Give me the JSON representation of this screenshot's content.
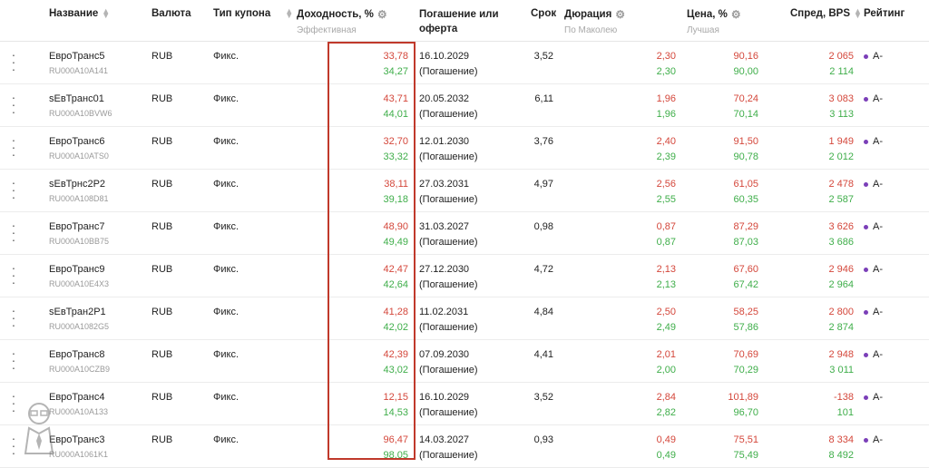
{
  "header": {
    "name": "Название",
    "currency": "Валюта",
    "coupon_type": "Тип купона",
    "yield": "Доходность, %",
    "yield_sub": "Эффективная",
    "maturity": "Погашение или оферта",
    "term": "Срок",
    "duration": "Дюрация",
    "duration_sub": "По Маколею",
    "price": "Цена, %",
    "price_sub": "Лучшая",
    "spread": "Спред, BPS",
    "rating": "Рейтинг"
  },
  "rows": [
    {
      "name": "ЕвроТранс5",
      "isin": "RU000A10A141",
      "currency": "RUB",
      "coupon": "Фикс.",
      "yield1": "33,78",
      "yield2": "34,27",
      "maturity": "16.10.2029",
      "maturity_note": "(Погашение)",
      "term": "3,52",
      "dur1": "2,30",
      "dur2": "2,30",
      "price1": "90,16",
      "price2": "90,00",
      "spread1": "2 065",
      "spread2": "2 114",
      "rating": "A-"
    },
    {
      "name": "sЕвТранс01",
      "isin": "RU000A10BVW6",
      "currency": "RUB",
      "coupon": "Фикс.",
      "yield1": "43,71",
      "yield2": "44,01",
      "maturity": "20.05.2032",
      "maturity_note": "(Погашение)",
      "term": "6,11",
      "dur1": "1,96",
      "dur2": "1,96",
      "price1": "70,24",
      "price2": "70,14",
      "spread1": "3 083",
      "spread2": "3 113",
      "rating": "A-"
    },
    {
      "name": "ЕвроТранс6",
      "isin": "RU000A10ATS0",
      "currency": "RUB",
      "coupon": "Фикс.",
      "yield1": "32,70",
      "yield2": "33,32",
      "maturity": "12.01.2030",
      "maturity_note": "(Погашение)",
      "term": "3,76",
      "dur1": "2,40",
      "dur2": "2,39",
      "price1": "91,50",
      "price2": "90,78",
      "spread1": "1 949",
      "spread2": "2 012",
      "rating": "A-"
    },
    {
      "name": "sЕвТрнс2P2",
      "isin": "RU000A108D81",
      "currency": "RUB",
      "coupon": "Фикс.",
      "yield1": "38,11",
      "yield2": "39,18",
      "maturity": "27.03.2031",
      "maturity_note": "(Погашение)",
      "term": "4,97",
      "dur1": "2,56",
      "dur2": "2,55",
      "price1": "61,05",
      "price2": "60,35",
      "spread1": "2 478",
      "spread2": "2 587",
      "rating": "A-"
    },
    {
      "name": "ЕвроТранс7",
      "isin": "RU000A10BB75",
      "currency": "RUB",
      "coupon": "Фикс.",
      "yield1": "48,90",
      "yield2": "49,49",
      "maturity": "31.03.2027",
      "maturity_note": "(Погашение)",
      "term": "0,98",
      "dur1": "0,87",
      "dur2": "0,87",
      "price1": "87,29",
      "price2": "87,03",
      "spread1": "3 626",
      "spread2": "3 686",
      "rating": "A-"
    },
    {
      "name": "ЕвроТранс9",
      "isin": "RU000A10E4X3",
      "currency": "RUB",
      "coupon": "Фикс.",
      "yield1": "42,47",
      "yield2": "42,64",
      "maturity": "27.12.2030",
      "maturity_note": "(Погашение)",
      "term": "4,72",
      "dur1": "2,13",
      "dur2": "2,13",
      "price1": "67,60",
      "price2": "67,42",
      "spread1": "2 946",
      "spread2": "2 964",
      "rating": "A-"
    },
    {
      "name": "sЕвТран2P1",
      "isin": "RU000A1082G5",
      "currency": "RUB",
      "coupon": "Фикс.",
      "yield1": "41,28",
      "yield2": "42,02",
      "maturity": "11.02.2031",
      "maturity_note": "(Погашение)",
      "term": "4,84",
      "dur1": "2,50",
      "dur2": "2,49",
      "price1": "58,25",
      "price2": "57,86",
      "spread1": "2 800",
      "spread2": "2 874",
      "rating": "A-"
    },
    {
      "name": "ЕвроТранс8",
      "isin": "RU000A10CZB9",
      "currency": "RUB",
      "coupon": "Фикс.",
      "yield1": "42,39",
      "yield2": "43,02",
      "maturity": "07.09.2030",
      "maturity_note": "(Погашение)",
      "term": "4,41",
      "dur1": "2,01",
      "dur2": "2,00",
      "price1": "70,69",
      "price2": "70,29",
      "spread1": "2 948",
      "spread2": "3 011",
      "rating": "A-"
    },
    {
      "name": "ЕвроТранс4",
      "isin": "RU000A10A133",
      "currency": "RUB",
      "coupon": "Фикс.",
      "yield1": "12,15",
      "yield2": "14,53",
      "maturity": "16.10.2029",
      "maturity_note": "(Погашение)",
      "term": "3,52",
      "dur1": "2,84",
      "dur2": "2,82",
      "price1": "101,89",
      "price2": "96,70",
      "spread1": "-138",
      "spread2": "101",
      "rating": "A-"
    },
    {
      "name": "ЕвроТранс3",
      "isin": "RU000A1061K1",
      "currency": "RUB",
      "coupon": "Фикс.",
      "yield1": "96,47",
      "yield2": "98,05",
      "maturity": "14.03.2027",
      "maturity_note": "(Погашение)",
      "term": "0,93",
      "dur1": "0,49",
      "dur2": "0,49",
      "price1": "75,51",
      "price2": "75,49",
      "spread1": "8 334",
      "spread2": "8 492",
      "rating": "A-"
    }
  ],
  "colors": {
    "negative": "#d4473b",
    "positive": "#3fae4a",
    "highlight": "#c0392b",
    "rating_dot": "#7b3fb8"
  }
}
